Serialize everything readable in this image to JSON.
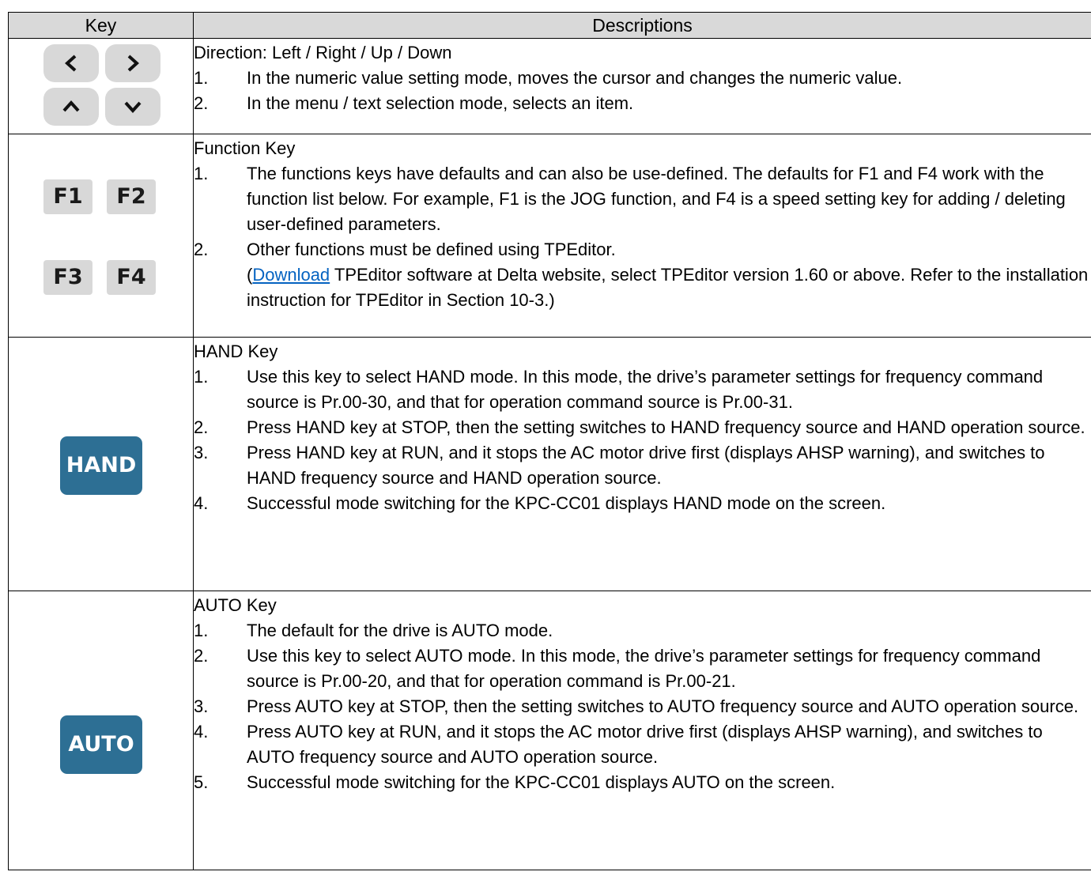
{
  "header": {
    "key": "Key",
    "descriptions": "Descriptions"
  },
  "rows": [
    {
      "keys": [
        "<",
        ">",
        "^",
        "v"
      ],
      "title": "Direction: Left / Right / Up / Down",
      "items": [
        {
          "n": "1.",
          "t": "In the numeric value setting mode, moves the cursor and changes the numeric value."
        },
        {
          "n": "2.",
          "t": "In the menu / text selection mode, selects an item."
        }
      ]
    },
    {
      "keys": [
        "F1",
        "F2",
        "F3",
        "F4"
      ],
      "title": "Function Key",
      "items": [
        {
          "n": "1.",
          "t": "The functions keys have defaults and can also be use-defined. The defaults for F1 and F4 work with the function list below. For example, F1 is the JOG function, and F4 is a speed setting key for adding / deleting user-defined parameters."
        },
        {
          "n": "2.",
          "t": "Other functions must be defined using TPEditor."
        }
      ],
      "note_open": "(",
      "note_link": "Download",
      "note_rest": " TPEditor software at Delta website, select TPEditor version 1.60 or above. Refer to the installation instruction for TPEditor in Section 10-3.)"
    },
    {
      "key_label": "HAND",
      "title": "HAND Key",
      "items": [
        {
          "n": "1.",
          "t": "Use this key to select HAND mode. In this mode, the drive’s parameter settings for frequency command source is Pr.00-30, and that for operation command source is Pr.00-31."
        },
        {
          "n": "2.",
          "t": "Press HAND key at STOP, then the setting switches to HAND frequency source and HAND operation source."
        },
        {
          "n": "3.",
          "t": "Press HAND key at RUN, and it stops the AC motor drive first (displays AHSP warning), and switches to HAND frequency source and HAND operation source."
        },
        {
          "n": "4.",
          "t": "Successful mode switching for the KPC-CC01 displays HAND mode on the screen."
        }
      ]
    },
    {
      "key_label": "AUTO",
      "title": "AUTO Key",
      "items": [
        {
          "n": "1.",
          "t": "The default for the drive is AUTO mode."
        },
        {
          "n": "2.",
          "t": "Use this key to select AUTO mode. In this mode, the drive’s parameter settings for frequency command source is Pr.00-20, and that for operation command is Pr.00-21."
        },
        {
          "n": "3.",
          "t": "Press AUTO key at STOP, then the setting switches to AUTO frequency source and AUTO operation source."
        },
        {
          "n": "4.",
          "t": "Press AUTO key at RUN, and it stops the AC motor drive first (displays AHSP warning), and switches to AUTO frequency source and AUTO operation source."
        },
        {
          "n": "5.",
          "t": "Successful mode switching for the KPC-CC01 displays AUTO on the screen."
        }
      ]
    }
  ]
}
